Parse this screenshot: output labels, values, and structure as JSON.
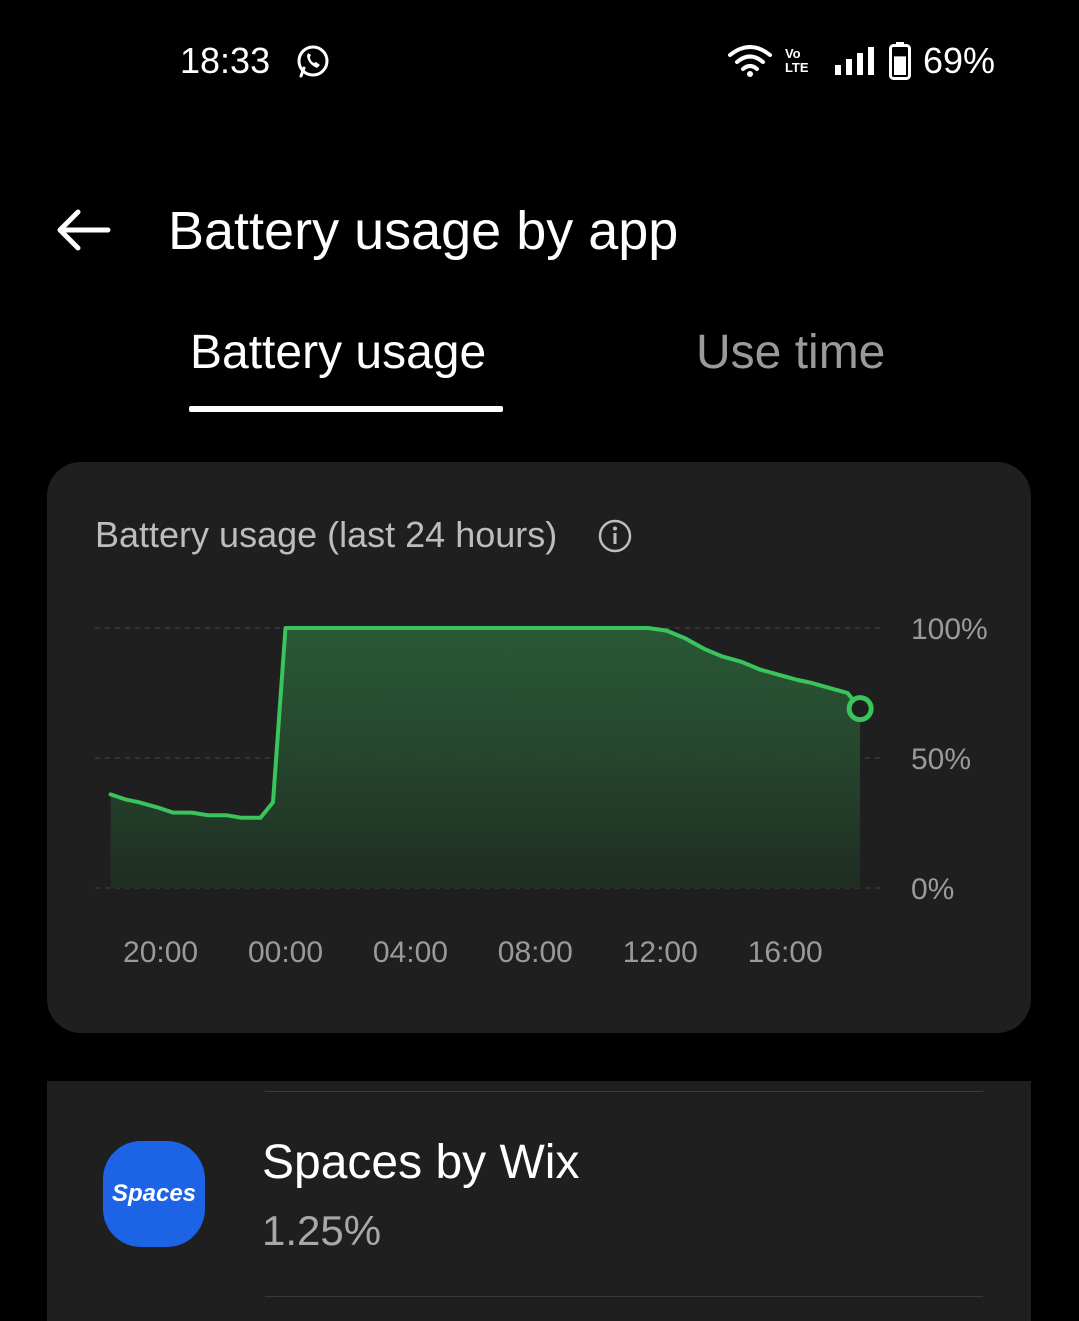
{
  "status_bar": {
    "time": "18:33",
    "battery_percent": "69%",
    "network_label": "Vo LTE",
    "battery_level": 0.69
  },
  "header": {
    "title": "Battery usage by app"
  },
  "tabs": [
    {
      "label": "Battery usage",
      "selected": true
    },
    {
      "label": "Use time",
      "selected": false
    }
  ],
  "chart": {
    "title": "Battery usage (last 24 hours)"
  },
  "chart_data": {
    "type": "area",
    "xlabel": "",
    "ylabel": "",
    "x_ticks": [
      "20:00",
      "00:00",
      "04:00",
      "08:00",
      "12:00",
      "16:00"
    ],
    "y_ticks": [
      "100%",
      "50%",
      "0%"
    ],
    "ylim": [
      0,
      100
    ],
    "grid": true,
    "color": "#39c45c",
    "x_hours_since_1800": [
      0.4,
      0.9,
      1.3,
      1.9,
      2.4,
      3.0,
      3.5,
      4.1,
      4.6,
      5.2,
      5.6,
      6.0,
      12.0,
      15.0,
      17.6,
      18.2,
      18.8,
      19.4,
      20.0,
      20.6,
      21.2,
      21.8,
      22.4,
      22.8,
      23.4,
      24.0,
      24.4
    ],
    "values": [
      36,
      34,
      33,
      31,
      29,
      29,
      28,
      28,
      27,
      27,
      33,
      100,
      100,
      100,
      100,
      99,
      96,
      92,
      89,
      87,
      84,
      82,
      80,
      79,
      77,
      75,
      69
    ]
  },
  "apps": [
    {
      "name": "Spaces by Wix",
      "usage": "1.25%",
      "icon_label": "Spaces",
      "icon_color": "#1c63e6"
    }
  ]
}
